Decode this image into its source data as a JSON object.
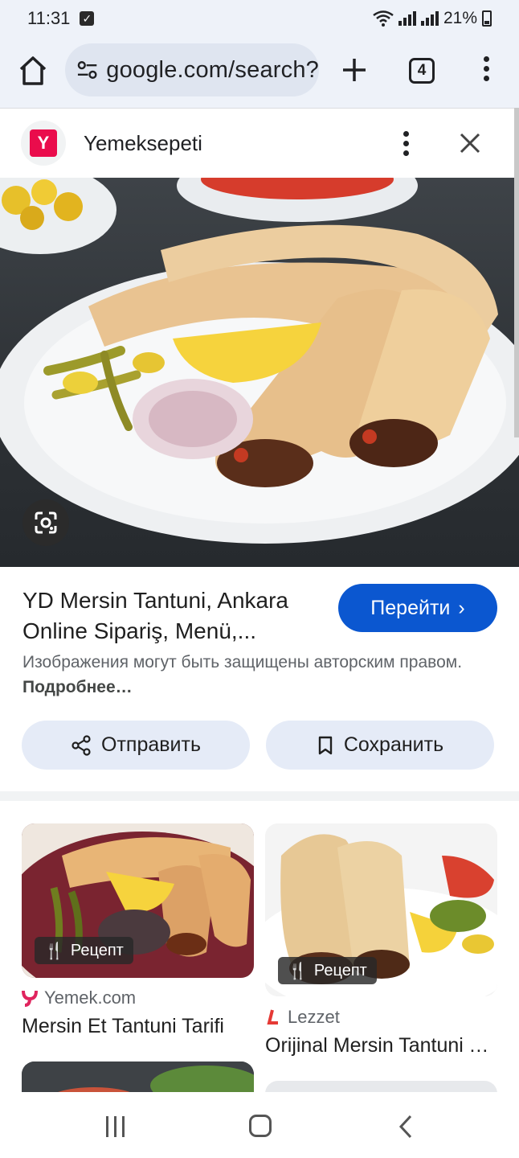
{
  "status_bar": {
    "time": "11:31",
    "battery": "21%"
  },
  "browser": {
    "url": "google.com/search?",
    "tab_count": "4"
  },
  "source": {
    "name": "Yemeksepeti",
    "logo_letter": "Y"
  },
  "result": {
    "title": "YD Mersin Tantuni, Ankara Online Sipariş, Menü,...",
    "go_button": "Перейти",
    "copyright_text": "Изображения могут быть защищены авторским правом.",
    "copyright_more": "Подробнее…",
    "share_button": "Отправить",
    "save_button": "Сохранить"
  },
  "related": [
    {
      "badge": "Рецепт",
      "source": "Yemek.com",
      "title": "Mersin Et Tantuni Tarifi"
    },
    {
      "badge": "Рецепт",
      "source": "Lezzet",
      "title": "Orijinal Mersin Tantuni Tarifi"
    }
  ],
  "colors": {
    "accent": "#0b57d0",
    "toolbar_bg": "#eef2f9",
    "pill_bg": "#e5ebf7",
    "brand_yemeksepeti": "#ea0c4c"
  },
  "icons": {
    "home": "home-icon",
    "site_settings": "tune-icon",
    "new_tab": "plus-icon",
    "tabs": "tab-switcher-icon",
    "menu": "more-vert-icon",
    "close": "close-icon",
    "lens": "google-lens-icon",
    "share": "share-icon",
    "save": "bookmark-icon",
    "recipe": "utensils-icon"
  }
}
